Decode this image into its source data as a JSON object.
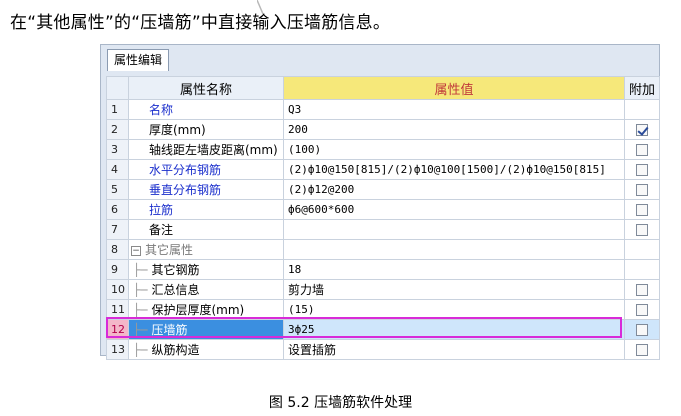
{
  "intro_text": "在“其他属性”的“压墙筋”中直接输入压墙筋信息。",
  "tab_label": "属性编辑",
  "columns": {
    "name": "属性名称",
    "value": "属性值",
    "extra": "附加"
  },
  "rows": [
    {
      "num": "1",
      "name": "名称",
      "value": "Q3",
      "style": "blue",
      "checkbox": "none"
    },
    {
      "num": "2",
      "name": "厚度(mm)",
      "value": "200",
      "style": "black",
      "checkbox": "checked"
    },
    {
      "num": "3",
      "name": "轴线距左墙皮距离(mm)",
      "value": "(100)",
      "style": "black",
      "checkbox": "unchecked"
    },
    {
      "num": "4",
      "name": "水平分布钢筋",
      "value": "(2)ф10@150[815]/(2)ф10@100[1500]/(2)ф10@150[815]",
      "style": "blue",
      "checkbox": "unchecked"
    },
    {
      "num": "5",
      "name": "垂直分布钢筋",
      "value": "(2)ф12@200",
      "style": "blue",
      "checkbox": "unchecked"
    },
    {
      "num": "6",
      "name": "拉筋",
      "value": "ф6@600*600",
      "style": "blue",
      "checkbox": "unchecked"
    },
    {
      "num": "7",
      "name": "备注",
      "value": "",
      "style": "black",
      "checkbox": "unchecked"
    },
    {
      "num": "8",
      "name": "其它属性",
      "value": "",
      "style": "group",
      "checkbox": "none"
    },
    {
      "num": "9",
      "name": "其它钢筋",
      "value": "18",
      "style": "child",
      "checkbox": "none"
    },
    {
      "num": "10",
      "name": "汇总信息",
      "value": "剪力墙",
      "style": "child",
      "checkbox": "unchecked"
    },
    {
      "num": "11",
      "name": "保护层厚度(mm)",
      "value": "(15)",
      "style": "child",
      "checkbox": "unchecked"
    },
    {
      "num": "12",
      "name": "压墙筋",
      "value": "3ф25",
      "style": "child",
      "checkbox": "unchecked",
      "selected": true
    },
    {
      "num": "13",
      "name": "纵筋构造",
      "value": "设置插筋",
      "style": "child",
      "checkbox": "unchecked"
    }
  ],
  "caption": "图 5.2  压墙筋软件处理",
  "colors": {
    "highlight_border": "#d82bd8",
    "selected_name_bg": "#3b8fe0",
    "value_header_bg": "#f6e87a"
  }
}
